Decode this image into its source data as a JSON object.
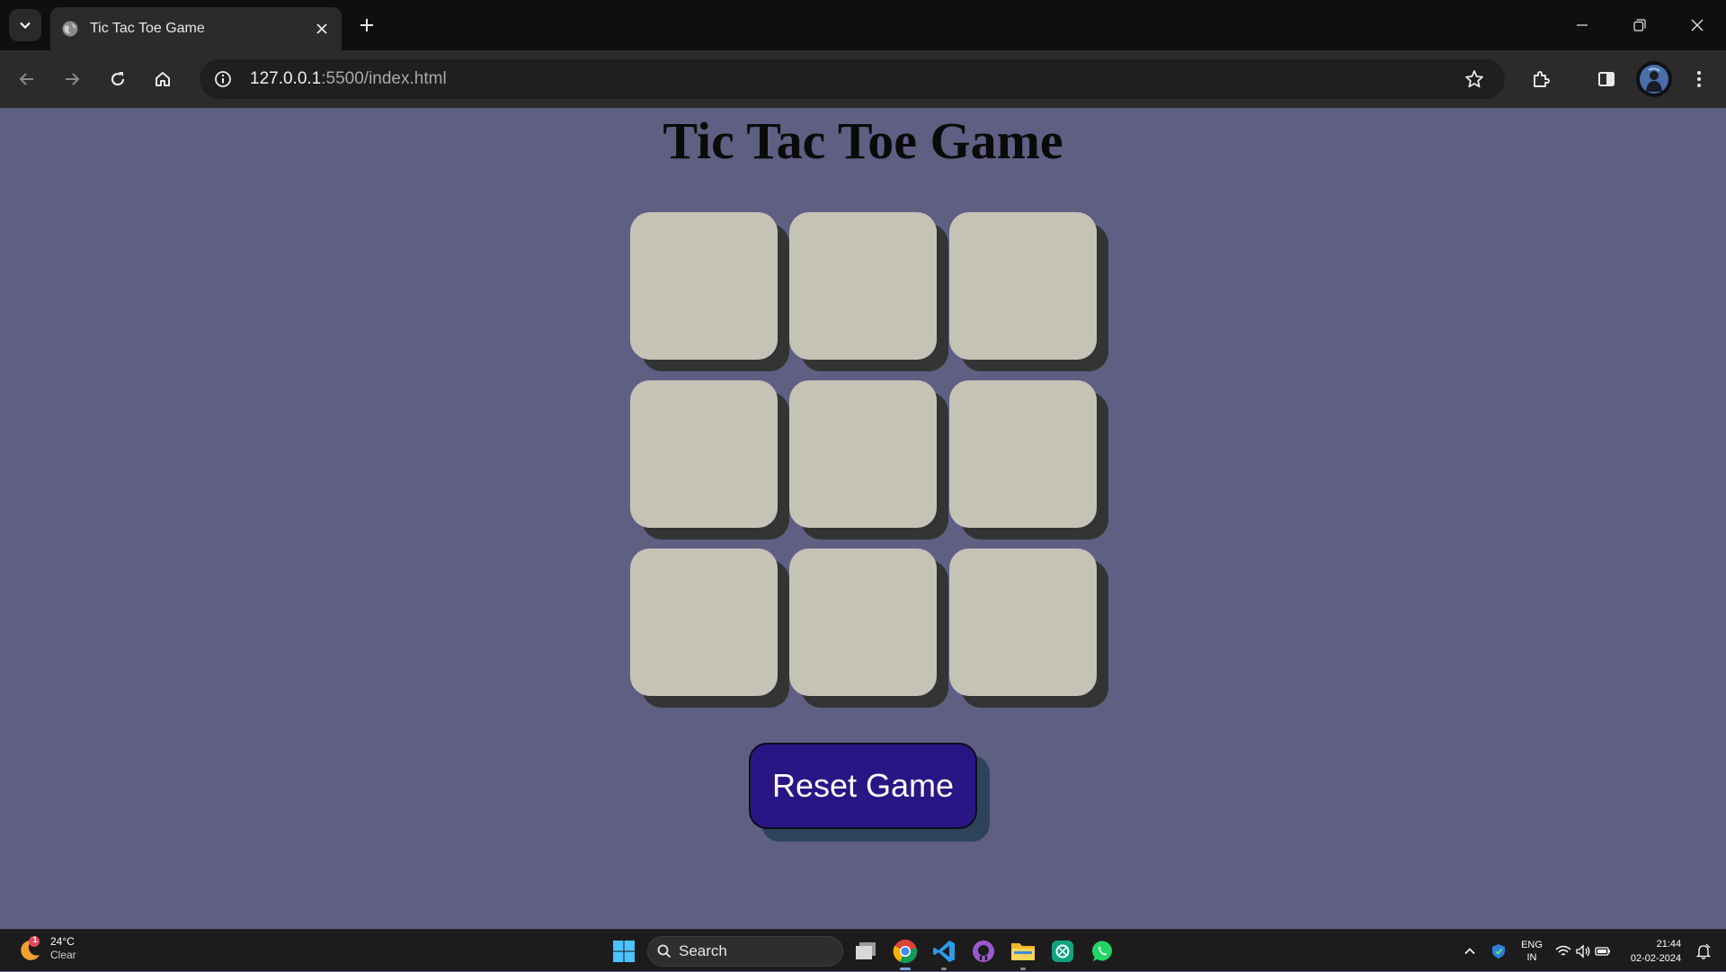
{
  "browser": {
    "tab_title": "Tic Tac Toe Game",
    "url_host": "127.0.0.1",
    "url_path": ":5500/index.html"
  },
  "page": {
    "title": "Tic Tac Toe Game",
    "cells": [
      "",
      "",
      "",
      "",
      "",
      "",
      "",
      "",
      ""
    ],
    "reset_label": "Reset Game"
  },
  "colors": {
    "page_bg": "#5f5f84",
    "cell_bg": "#c5c3b6",
    "cell_shadow": "#343434",
    "button_bg": "#2a1584",
    "button_shadow": "#2d4359"
  },
  "taskbar": {
    "weather_temp": "24°C",
    "weather_cond": "Clear",
    "weather_badge": "1",
    "search_label": "Search",
    "apps": [
      "file-explorer-task-view-icon",
      "chrome-icon",
      "vscode-icon",
      "github-desktop-icon",
      "folder-icon",
      "chatgpt-icon",
      "whatsapp-icon"
    ],
    "lang_line1": "ENG",
    "lang_line2": "IN",
    "time": "21:44",
    "date": "02-02-2024"
  }
}
